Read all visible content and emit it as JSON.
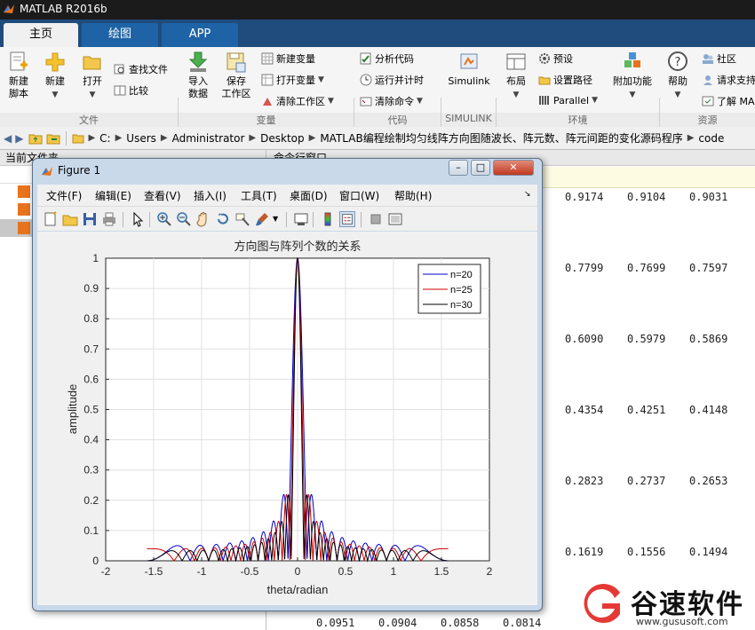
{
  "app": {
    "title": "MATLAB R2016b"
  },
  "tabs": [
    {
      "label": "主页"
    },
    {
      "label": "绘图"
    },
    {
      "label": "APP"
    }
  ],
  "ribbon": {
    "new_script": "新建\n脚本",
    "new": "新建",
    "open": "打开",
    "find_files": "查找文件",
    "compare": "比较",
    "import_data": "导入\n数据",
    "save_workspace": "保存\n工作区",
    "new_variable": "新建变量",
    "open_variable": "打开变量",
    "clear_workspace": "清除工作区",
    "analyze_code": "分析代码",
    "run_time": "运行并计时",
    "clear_commands": "清除命令",
    "simulink": "Simulink",
    "layout": "布局",
    "preferences": "预设",
    "set_path": "设置路径",
    "parallel": "Parallel",
    "addons": "附加功能",
    "help": "帮助",
    "community": "社区",
    "request_support": "请求支持",
    "learn": "了解 MA",
    "groups": {
      "file": "文件",
      "variable": "变量",
      "code": "代码",
      "simulink": "SIMULINK",
      "environment": "环境",
      "resources": "资源"
    }
  },
  "address": {
    "segments": [
      "C:",
      "Users",
      "Administrator",
      "Desktop",
      "MATLAB编程绘制均匀线阵方向图随波长、阵元数、阵元间距的变化源码程序",
      "code"
    ]
  },
  "left_panel": {
    "title": "当前文件夹"
  },
  "command_window": {
    "title": "命令行窗口",
    "rows": [
      [
        "0.9174",
        "0.9104",
        "0.9031"
      ],
      [
        "0.7799",
        "0.7699",
        "0.7597"
      ],
      [
        "0.6090",
        "0.5979",
        "0.5869"
      ],
      [
        "0.4354",
        "0.4251",
        "0.4148"
      ],
      [
        "0.2823",
        "0.2737",
        "0.2653"
      ],
      [
        "0.1619",
        "0.1556",
        "0.1494"
      ]
    ],
    "bottom_row": [
      "0.0951",
      "0.0904",
      "0.0858",
      "0.0814"
    ]
  },
  "figure": {
    "title": "Figure 1",
    "menu": [
      "文件(F)",
      "编辑(E)",
      "查看(V)",
      "插入(I)",
      "工具(T)",
      "桌面(D)",
      "窗口(W)",
      "帮助(H)"
    ]
  },
  "chart_data": {
    "type": "line",
    "title": "方向图与阵列个数的关系",
    "xlabel": "theta/radian",
    "ylabel": "amplitude",
    "xlim": [
      -2,
      2
    ],
    "ylim": [
      0,
      1
    ],
    "xticks": [
      -2,
      -1.5,
      -1,
      -0.5,
      0,
      0.5,
      1,
      1.5,
      2
    ],
    "yticks": [
      0,
      0.1,
      0.2,
      0.3,
      0.4,
      0.5,
      0.6,
      0.7,
      0.8,
      0.9,
      1
    ],
    "grid": true,
    "legend_position": "top-right",
    "function": "|sin(N*pi/2*sin(theta)) / (N*sin(pi/2*sin(theta)))|",
    "theta_range": [
      -1.5708,
      1.5708
    ],
    "series": [
      {
        "name": "n=20",
        "N": 20,
        "color": "#0000cc"
      },
      {
        "name": "n=25",
        "N": 25,
        "color": "#cc0000"
      },
      {
        "name": "n=30",
        "N": 30,
        "color": "#000000"
      }
    ]
  },
  "watermark": {
    "brand": "谷速软件",
    "url": "www.gususoft.com"
  }
}
